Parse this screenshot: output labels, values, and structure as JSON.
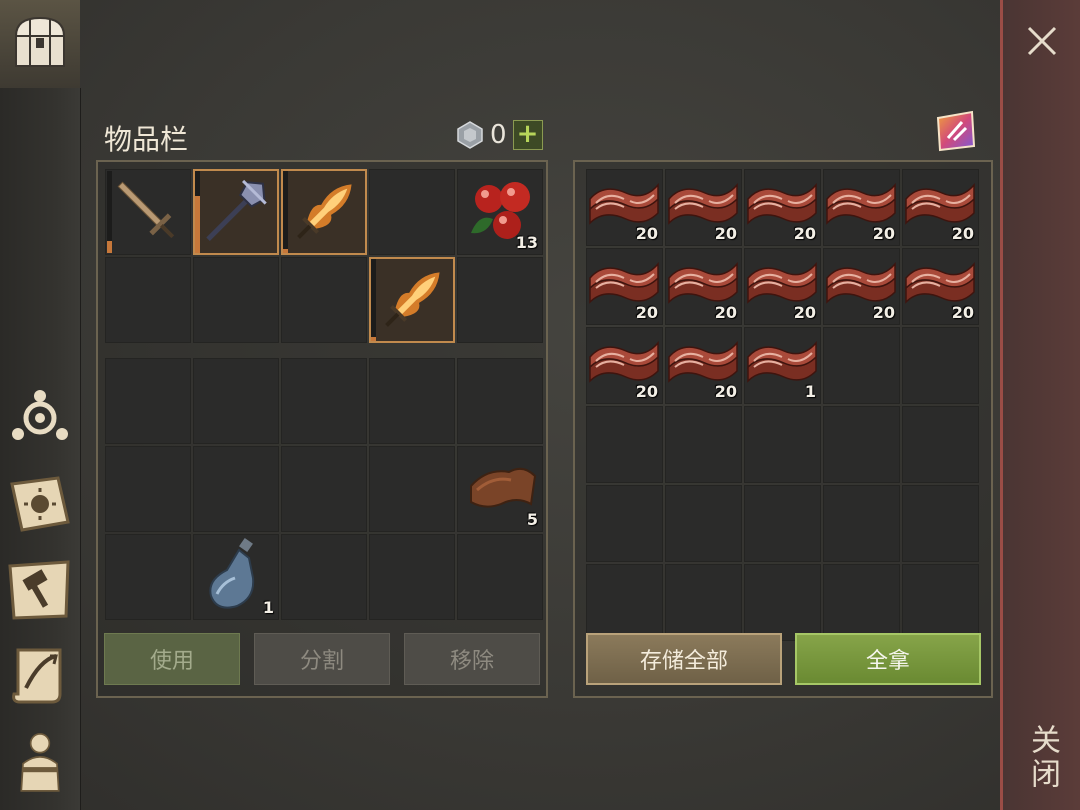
{
  "inventory": {
    "title": "物品栏",
    "currency_count": "0",
    "plus_label": "+",
    "equip_items": [
      {
        "slot": 0,
        "name": "wooden-sword",
        "durability_pct": 15
      },
      {
        "slot": 1,
        "name": "iron-mace",
        "durability_pct": 70,
        "highlight": true
      },
      {
        "slot": 2,
        "name": "flame-sword",
        "durability_pct": 5,
        "highlight": true
      },
      {
        "slot": 4,
        "name": "red-berries",
        "qty": "13"
      },
      {
        "slot": 8,
        "name": "flame-sword",
        "durability_pct": 5,
        "highlight": true
      }
    ],
    "bag_items": [
      {
        "slot": 9,
        "name": "leather-hide",
        "qty": "5"
      },
      {
        "slot": 11,
        "name": "empty-flask",
        "qty": "1"
      }
    ],
    "buttons": {
      "use": "使用",
      "split": "分割",
      "remove": "移除"
    }
  },
  "storage": {
    "items": [
      {
        "name": "raw-meat",
        "qty": "20"
      },
      {
        "name": "raw-meat",
        "qty": "20"
      },
      {
        "name": "raw-meat",
        "qty": "20"
      },
      {
        "name": "raw-meat",
        "qty": "20"
      },
      {
        "name": "raw-meat",
        "qty": "20"
      },
      {
        "name": "raw-meat",
        "qty": "20"
      },
      {
        "name": "raw-meat",
        "qty": "20"
      },
      {
        "name": "raw-meat",
        "qty": "20"
      },
      {
        "name": "raw-meat",
        "qty": "20"
      },
      {
        "name": "raw-meat",
        "qty": "20"
      },
      {
        "name": "raw-meat",
        "qty": "20"
      },
      {
        "name": "raw-meat",
        "qty": "20"
      },
      {
        "name": "raw-meat",
        "qty": "1"
      }
    ],
    "buttons": {
      "store_all": "存储全部",
      "take_all": "全拿"
    }
  },
  "close": {
    "label": "关闭"
  },
  "sidebar": {
    "icons": [
      "chest-icon",
      "skills-icon",
      "sun-book-icon",
      "crafting-hammer-icon",
      "quest-scroll-icon",
      "character-icon"
    ]
  },
  "colors": {
    "accent_orange": "#c18a4d",
    "take_green": "#86a449",
    "close_red": "#9a4d46"
  }
}
